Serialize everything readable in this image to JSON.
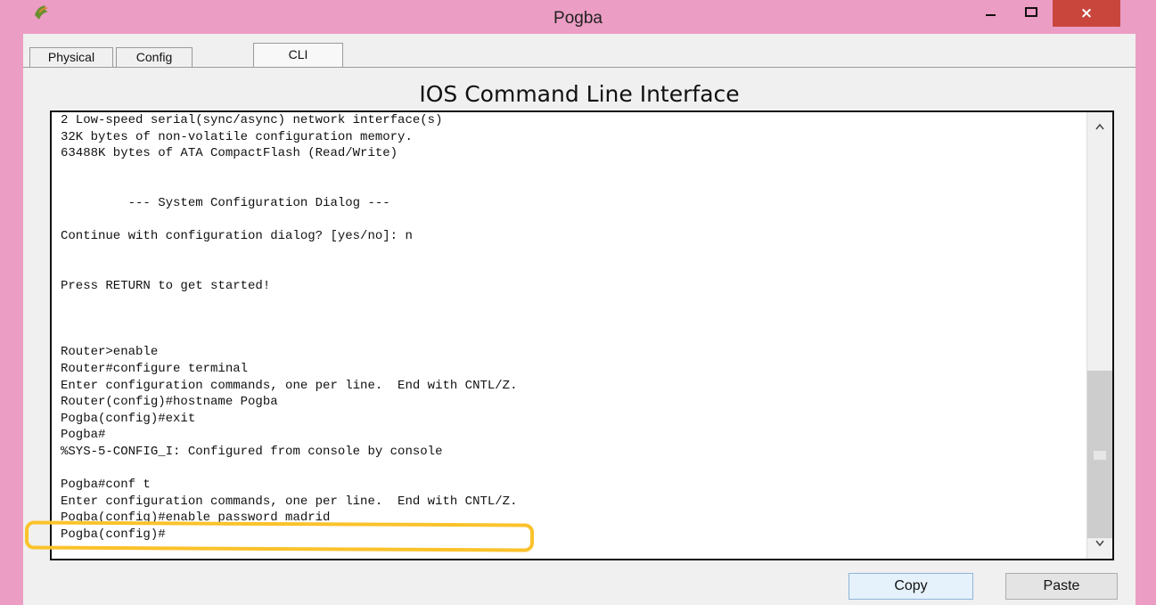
{
  "window": {
    "title": "Pogba",
    "icon": "packet-tracer-icon",
    "close_label": "×"
  },
  "tabs": [
    {
      "label": "Physical",
      "active": false
    },
    {
      "label": "Config",
      "active": false
    },
    {
      "label": "CLI",
      "active": true
    }
  ],
  "cli": {
    "heading": "IOS Command Line Interface",
    "lines": [
      "2 Low-speed serial(sync/async) network interface(s)",
      "32K bytes of non-volatile configuration memory.",
      "63488K bytes of ATA CompactFlash (Read/Write)",
      "",
      "",
      "         --- System Configuration Dialog ---",
      "",
      "Continue with configuration dialog? [yes/no]: n",
      "",
      "",
      "Press RETURN to get started!",
      "",
      "",
      "",
      "Router>enable",
      "Router#configure terminal",
      "Enter configuration commands, one per line.  End with CNTL/Z.",
      "Router(config)#hostname Pogba",
      "Pogba(config)#exit",
      "Pogba#",
      "%SYS-5-CONFIG_I: Configured from console by console",
      "",
      "Pogba#conf t",
      "Enter configuration commands, one per line.  End with CNTL/Z.",
      "Pogba(config)#enable password madrid",
      "Pogba(config)#"
    ]
  },
  "buttons": {
    "copy": "Copy",
    "paste": "Paste"
  },
  "colors": {
    "titlebar": "#ec9dc4",
    "close": "#c9463d",
    "highlight": "#fbc22b"
  }
}
